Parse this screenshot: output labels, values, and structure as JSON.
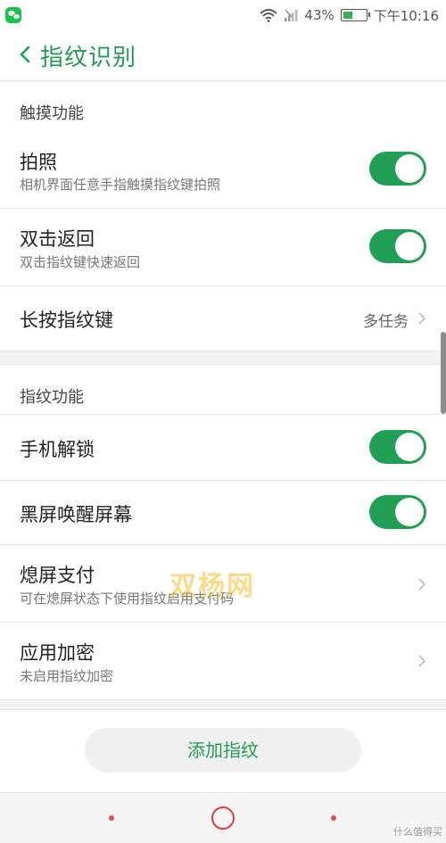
{
  "status": {
    "battery": "43%",
    "battery_level": 0.43,
    "time": "下午10:16"
  },
  "header": {
    "title": "指纹识别"
  },
  "sections": [
    {
      "header": "触摸功能",
      "items": [
        {
          "title": "拍照",
          "subtitle": "相机界面任意手指触摸指纹键拍照",
          "toggle": true
        },
        {
          "title": "双击返回",
          "subtitle": "双击指纹键快速返回",
          "toggle": true
        },
        {
          "title": "长按指纹键",
          "value": "多任务"
        }
      ]
    },
    {
      "header": "指纹功能",
      "items": [
        {
          "title": "手机解锁",
          "toggle": true
        },
        {
          "title": "黑屏唤醒屏幕",
          "toggle": true
        },
        {
          "title": "熄屏支付",
          "subtitle": "可在熄屏状态下使用指纹启用支付码"
        },
        {
          "title": "应用加密",
          "subtitle": "未启用指纹加密"
        }
      ]
    }
  ],
  "footer": {
    "add_button": "添加指纹"
  },
  "watermark": "双杨网",
  "corner_mark": "什么值得买",
  "colors": {
    "accent": "#229b55",
    "toggle_on": "#21a055",
    "nav_accent": "#e23b3b"
  }
}
